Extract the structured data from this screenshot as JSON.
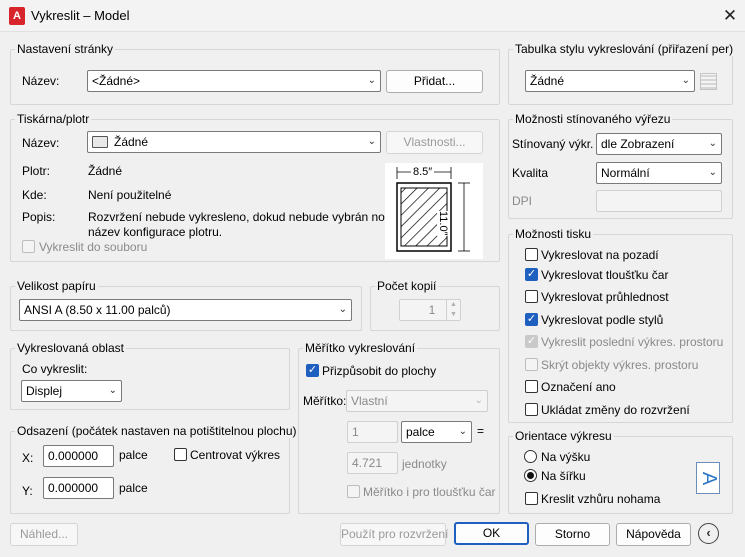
{
  "window": {
    "title": "Vykreslit – Model",
    "app_icon_letter": "A"
  },
  "page_setup": {
    "legend": "Nastavení stránky",
    "name_label": "Název:",
    "name_value": "<Žádné>",
    "add_button": "Přidat..."
  },
  "printer": {
    "legend": "Tiskárna/plotr",
    "name_label": "Název:",
    "name_value": "Žádné",
    "properties_button": "Vlastnosti...",
    "plotter_label": "Plotr:",
    "plotter_value": "Žádné",
    "where_label": "Kde:",
    "where_value": "Není použitelné",
    "description_label": "Popis:",
    "description_line1": "Rozvržení nebude vykresleno, dokud nebude vybrán nový",
    "description_line2": "název konfigurace plotru.",
    "plot_to_file": "Vykreslit do souboru",
    "preview_width": "8.5″",
    "preview_height": "11.0″"
  },
  "paper_size": {
    "legend": "Velikost papíru",
    "value": "ANSI A (8.50 x 11.00 palců)"
  },
  "copies": {
    "legend": "Počet kopií",
    "value": "1"
  },
  "plot_area": {
    "legend": "Vykreslovaná oblast",
    "what_label": "Co vykreslit:",
    "what_value": "Displej"
  },
  "plot_offset": {
    "legend": "Odsazení (počátek nastaven na potištitelnou plochu)",
    "x_label": "X:",
    "x_value": "0.000000",
    "x_unit": "palce",
    "y_label": "Y:",
    "y_value": "0.000000",
    "y_unit": "palce",
    "center": "Centrovat výkres"
  },
  "plot_scale": {
    "legend": "Měřítko vykreslování",
    "fit": "Přizpůsobit do plochy",
    "scale_label": "Měřítko:",
    "scale_value": "Vlastní",
    "value1": "1",
    "unit1": "palce",
    "value2": "4.721",
    "unit2": "jednotky",
    "scale_lineweights": "Měřítko i pro tloušťku čar"
  },
  "style_table": {
    "legend": "Tabulka stylu vykreslování (přiřazení per)",
    "value": "Žádné"
  },
  "shaded": {
    "legend": "Možnosti stínovaného výřezu",
    "shade_label": "Stínovaný výkr.",
    "shade_value": "dle Zobrazení",
    "quality_label": "Kvalita",
    "quality_value": "Normální",
    "dpi_label": "DPI"
  },
  "options": {
    "legend": "Možnosti tisku",
    "items": [
      "Vykreslovat na pozadí",
      "Vykreslovat tloušťku čar",
      "Vykreslovat průhlednost",
      "Vykreslovat podle stylů",
      "Vykreslit poslední výkres. prostoru",
      "Skrýt objekty výkres. prostoru",
      "Označení ano",
      "Ukládat změny do rozvržení"
    ]
  },
  "orientation": {
    "legend": "Orientace výkresu",
    "portrait": "Na výšku",
    "landscape": "Na šířku",
    "upside_down": "Kreslit vzhůru nohama",
    "icon_letter": "A"
  },
  "footer": {
    "preview": "Náhled...",
    "apply": "Použít pro rozvržení",
    "ok": "OK",
    "cancel": "Storno",
    "help": "Nápověda"
  }
}
